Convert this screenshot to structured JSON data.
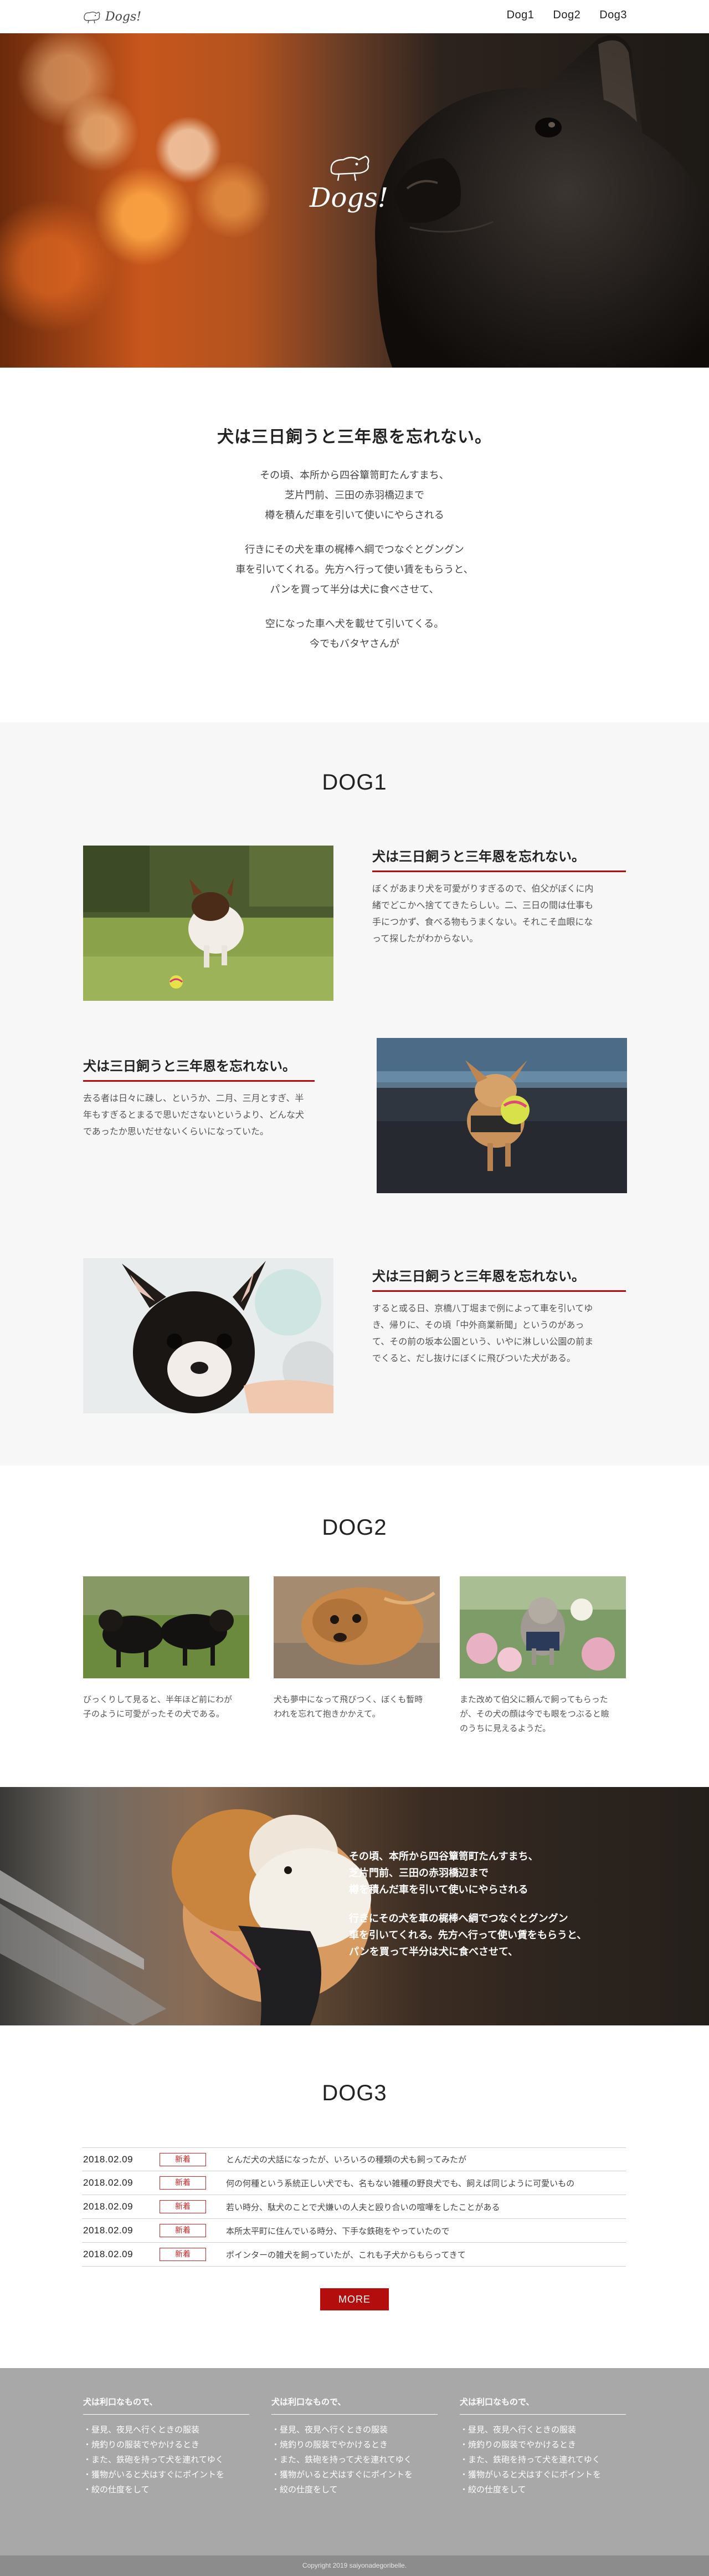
{
  "header": {
    "logo_text": "Dogs!",
    "nav": [
      "Dog1",
      "Dog2",
      "Dog3"
    ]
  },
  "hero": {
    "logo_text": "Dogs!"
  },
  "intro": {
    "title": "犬は三日飼うと三年恩を忘れない。",
    "paragraphs": [
      [
        "その頃、本所から四谷簞笥町たんすまち、",
        "芝片門前、三田の赤羽橋辺まで",
        "樽を積んだ車を引いて使いにやらされる"
      ],
      [
        "行きにその犬を車の梶棒へ綱でつなぐとグングン",
        "車を引いてくれる。先方へ行って使い賃をもらうと、",
        "パンを買って半分は犬に食べさせて、"
      ],
      [
        "空になった車へ犬を載せて引いてくる。",
        "今でもバタヤさんが"
      ]
    ]
  },
  "dog1": {
    "title": "DOG1",
    "rows": [
      {
        "heading": "犬は三日飼うと三年恩を忘れない。",
        "lines": [
          "ぼくがあまり犬を可愛がりすぎるので、伯父がぼくに内",
          "緒でどこかへ捨ててきたらしい。二、三日の間は仕事も",
          "手につかず、食べる物もうまくない。それこそ血眼にな",
          "って探したがわからない。"
        ]
      },
      {
        "heading": "犬は三日飼うと三年恩を忘れない。",
        "lines": [
          "去る者は日々に疎し、というか、二月、三月とすぎ、半",
          "年もすぎるとまるで思いださないというより、どんな犬",
          "であったか思いだせないくらいになっていた。"
        ]
      },
      {
        "heading": "犬は三日飼うと三年恩を忘れない。",
        "lines": [
          "すると或る日、京橋八丁堀まで例によって車を引いてゆ",
          "き、帰りに、その頃「中外商業新聞」というのがあっ",
          "て、その前の坂本公園という、いやに淋しい公園の前ま",
          "でくると、だし抜けにぼくに飛びついた犬がある。"
        ]
      }
    ]
  },
  "dog2": {
    "title": "DOG2",
    "cards": [
      {
        "lines": [
          "びっくりして見ると、半年ほど前にわが",
          "子のように可愛がったその犬である。"
        ]
      },
      {
        "lines": [
          "犬も夢中になって飛びつく、ぼくも暫時",
          "われを忘れて抱きかかえて。"
        ]
      },
      {
        "lines": [
          "また改めて伯父に頼んで飼ってもらった",
          "が、その犬の顔は今でも眼をつぶると瞼",
          "のうちに見えるようだ。"
        ]
      }
    ]
  },
  "banner": {
    "lines_a": [
      "その頃、本所から四谷簞笥町たんすまち、",
      "芝片門前、三田の赤羽橋辺まで",
      "樽を積んだ車を引いて使いにやらされる"
    ],
    "lines_b": [
      "行きにその犬を車の梶棒へ綱でつなぐとグングン",
      "車を引いてくれる。先方へ行って使い賃をもらうと、",
      "パンを買って半分は犬に食べさせて、"
    ]
  },
  "dog3": {
    "title": "DOG3",
    "news": [
      {
        "date": "2018.02.09",
        "badge": "新着",
        "text": "とんだ犬の犬話になったが、いろいろの種類の犬も飼ってみたが"
      },
      {
        "date": "2018.02.09",
        "badge": "新着",
        "text": "何の何種という系統正しい犬でも、名もない雑種の野良犬でも、飼えば同じように可愛いもの"
      },
      {
        "date": "2018.02.09",
        "badge": "新着",
        "text": "若い時分、駄犬のことで犬嫌いの人夫と殴り合いの喧嘩をしたことがある"
      },
      {
        "date": "2018.02.09",
        "badge": "新着",
        "text": "本所太平町に住んでいる時分、下手な鉄砲をやっていたので"
      },
      {
        "date": "2018.02.09",
        "badge": "新着",
        "text": "ポインターの雑犬を飼っていたが、これも子犬からもらってきて"
      }
    ],
    "more_label": "MORE"
  },
  "footer": {
    "columns": [
      {
        "title": "犬は利口なもので、",
        "items": [
          "・昼見、夜見へ行くときの服装",
          "・焼釣りの服装でやかけるとき",
          "・また、鉄砲を持って犬を連れてゆく",
          "・獲物がいると犬はすぐにポイントを",
          "・絞の仕度をして"
        ]
      },
      {
        "title": "犬は利口なもので、",
        "items": [
          "・昼見、夜見へ行くときの服装",
          "・焼釣りの服装でやかけるとき",
          "・また、鉄砲を持って犬を連れてゆく",
          "・獲物がいると犬はすぐにポイントを",
          "・絞の仕度をして"
        ]
      },
      {
        "title": "犬は利口なもので、",
        "items": [
          "・昼見、夜見へ行くときの服装",
          "・焼釣りの服装でやかけるとき",
          "・また、鉄砲を持って犬を連れてゆく",
          "・獲物がいると犬はすぐにポイントを",
          "・絞の仕度をして"
        ]
      }
    ],
    "copyright": "Copyright 2019 saiyonadegoribelle."
  },
  "colors": {
    "accent": "#b30d0d",
    "footer_bg": "#a8a8a8",
    "section_bg": "#f7f7f7"
  }
}
